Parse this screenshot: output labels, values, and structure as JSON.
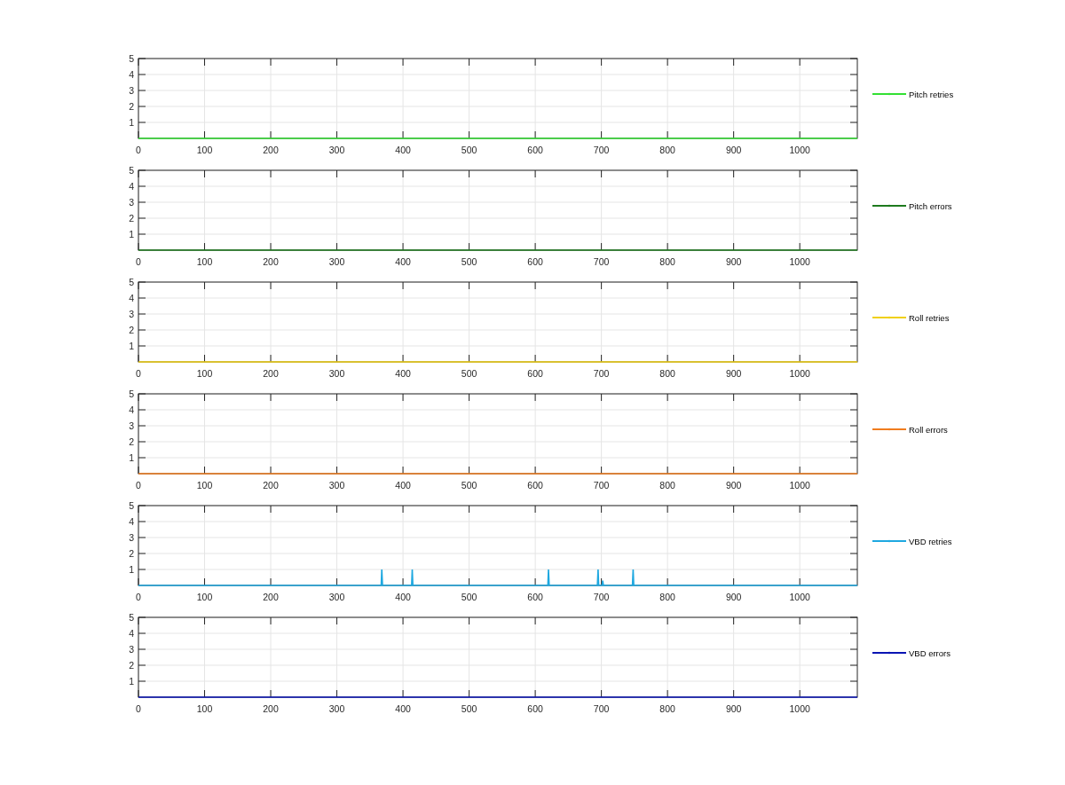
{
  "charts": [
    {
      "chart_data": {
        "type": "line",
        "grid": true,
        "x": [
          0,
          1087
        ],
        "xlim": [
          0,
          1087
        ],
        "ylim": [
          0,
          5
        ],
        "xticks": [
          0,
          100,
          200,
          300,
          400,
          500,
          600,
          700,
          800,
          900,
          1000
        ],
        "yticks": [
          1,
          2,
          3,
          4,
          5
        ],
        "series": [
          {
            "name": "Pitch retries",
            "color": "#33e033",
            "values": [
              0,
              0
            ]
          }
        ]
      }
    },
    {
      "chart_data": {
        "type": "line",
        "grid": true,
        "x": [
          0,
          1087
        ],
        "xlim": [
          0,
          1087
        ],
        "ylim": [
          0,
          5
        ],
        "xticks": [
          0,
          100,
          200,
          300,
          400,
          500,
          600,
          700,
          800,
          900,
          1000
        ],
        "yticks": [
          1,
          2,
          3,
          4,
          5
        ],
        "series": [
          {
            "name": "Pitch errors",
            "color": "#1e7a1e",
            "values": [
              0,
              0
            ]
          }
        ]
      }
    },
    {
      "chart_data": {
        "type": "line",
        "grid": true,
        "x": [
          0,
          1087
        ],
        "xlim": [
          0,
          1087
        ],
        "ylim": [
          0,
          5
        ],
        "xticks": [
          0,
          100,
          200,
          300,
          400,
          500,
          600,
          700,
          800,
          900,
          1000
        ],
        "yticks": [
          1,
          2,
          3,
          4,
          5
        ],
        "series": [
          {
            "name": "Roll retries",
            "color": "#f0d010",
            "values": [
              0,
              0
            ]
          }
        ]
      }
    },
    {
      "chart_data": {
        "type": "line",
        "grid": true,
        "x": [
          0,
          1087
        ],
        "xlim": [
          0,
          1087
        ],
        "ylim": [
          0,
          5
        ],
        "xticks": [
          0,
          100,
          200,
          300,
          400,
          500,
          600,
          700,
          800,
          900,
          1000
        ],
        "yticks": [
          1,
          2,
          3,
          4,
          5
        ],
        "series": [
          {
            "name": "Roll errors",
            "color": "#f07c1e",
            "values": [
              0,
              0
            ]
          }
        ]
      }
    },
    {
      "chart_data": {
        "type": "line",
        "grid": true,
        "x": [
          0,
          367,
          368,
          369,
          413,
          414,
          415,
          619,
          620,
          621,
          694,
          695,
          696,
          701,
          702,
          703,
          747,
          748,
          749,
          1087
        ],
        "xlim": [
          0,
          1087
        ],
        "ylim": [
          0,
          5
        ],
        "xticks": [
          0,
          100,
          200,
          300,
          400,
          500,
          600,
          700,
          800,
          900,
          1000
        ],
        "yticks": [
          1,
          2,
          3,
          4,
          5
        ],
        "series": [
          {
            "name": "VBD retries",
            "color": "#1ea8e0",
            "values": [
              0,
              0,
              1,
              0,
              0,
              1,
              0,
              0,
              1,
              0,
              0,
              1,
              0,
              0,
              0.3,
              0,
              0,
              1,
              0,
              0
            ]
          }
        ]
      }
    },
    {
      "chart_data": {
        "type": "line",
        "grid": true,
        "x": [
          0,
          1087
        ],
        "xlim": [
          0,
          1087
        ],
        "ylim": [
          0,
          5
        ],
        "xticks": [
          0,
          100,
          200,
          300,
          400,
          500,
          600,
          700,
          800,
          900,
          1000
        ],
        "yticks": [
          1,
          2,
          3,
          4,
          5
        ],
        "series": [
          {
            "name": "VBD errors",
            "color": "#0a14b4",
            "values": [
              0,
              0
            ]
          }
        ]
      }
    }
  ]
}
